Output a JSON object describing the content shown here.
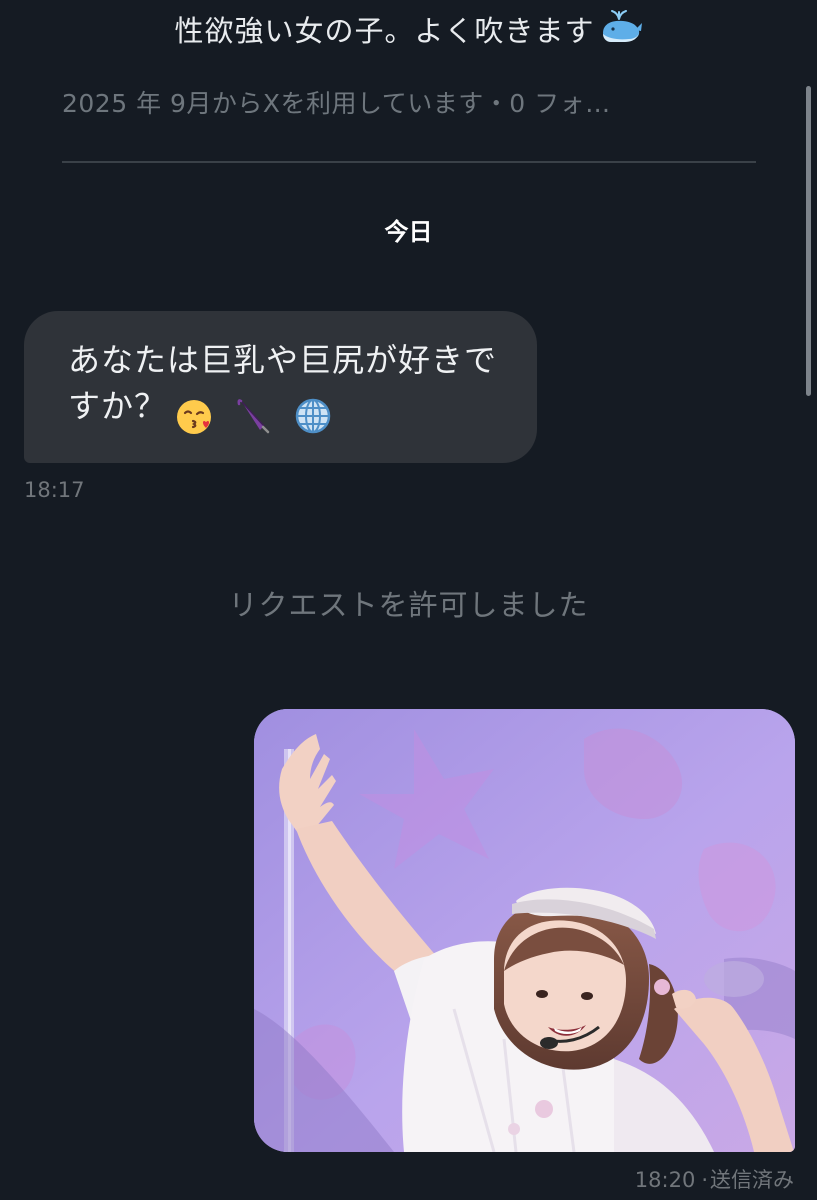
{
  "header": {
    "bio": "性欲強い女の子。よく吹きます",
    "bio_emoji": "spouting-whale",
    "joined_line": "2025 年 9月からXを利用しています・0 フォ…"
  },
  "conversation": {
    "day_separator": "今日",
    "messages": [
      {
        "direction": "incoming",
        "text": "あなたは巨乳や巨尻が好きですか？",
        "emojis": [
          "kissing-face-with-heart",
          "closed-umbrella",
          "globe-with-meridians"
        ],
        "time": "18:17"
      }
    ],
    "system_message": "リクエストを許可しました",
    "outgoing": {
      "type": "image",
      "image_description_icon": "photo-of-performer-waving",
      "time": "18:20",
      "separator": "·",
      "status": "送信済み"
    }
  },
  "colors": {
    "background": "#151b23",
    "incoming_bubble": "#2f3339",
    "muted_text": "#71767b",
    "primary_text": "#eff1f3"
  }
}
